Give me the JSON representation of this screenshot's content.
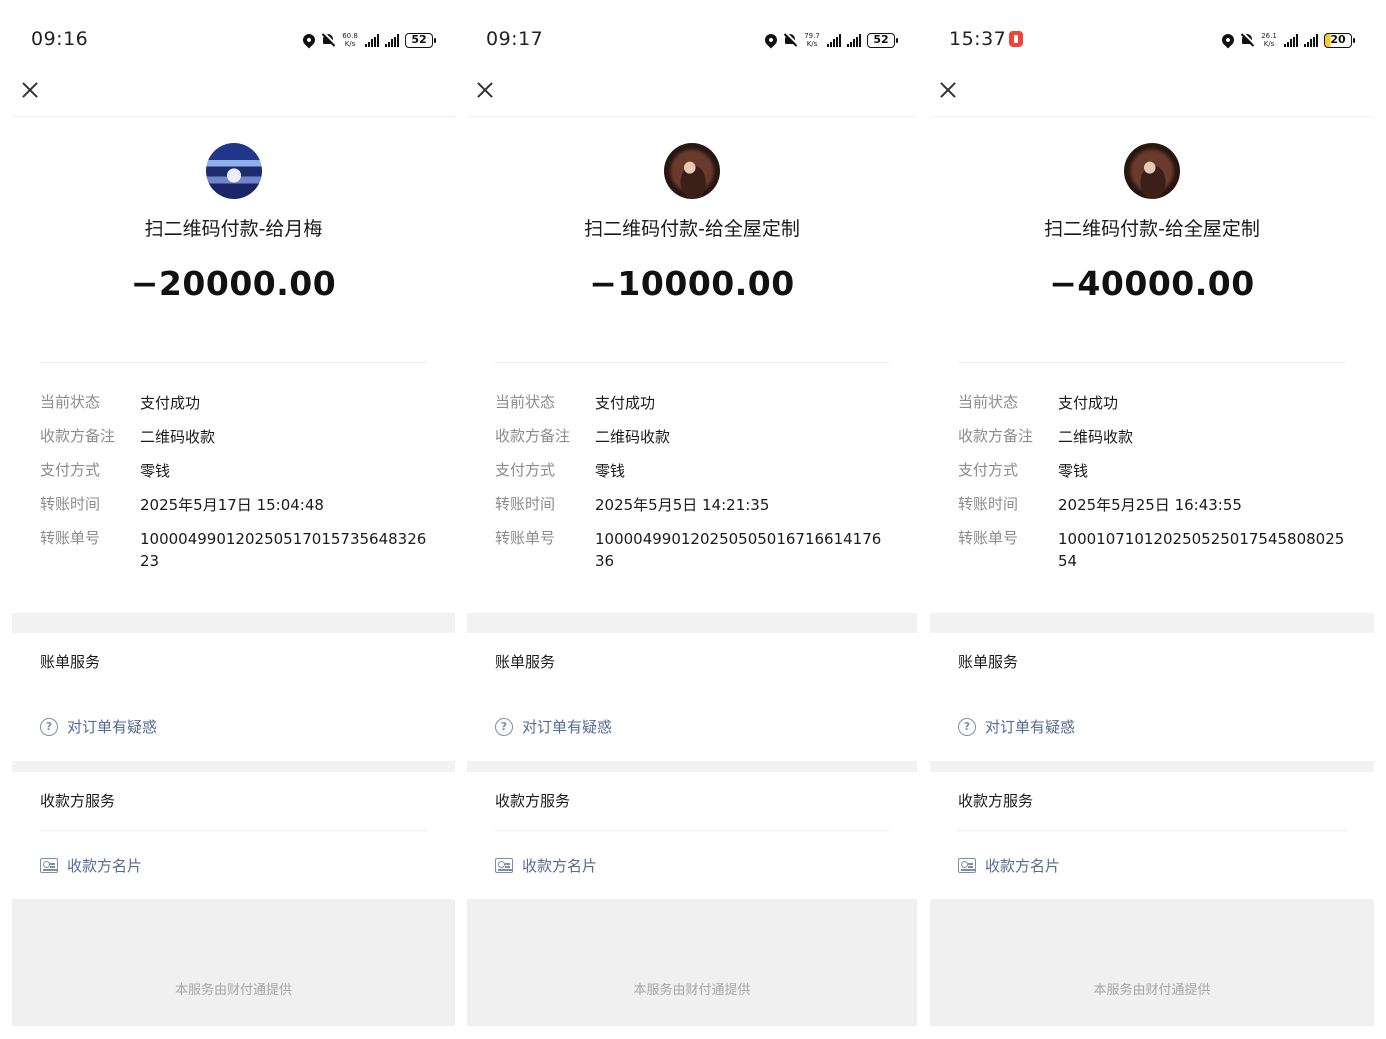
{
  "common": {
    "section_bill": "账单服务",
    "link_question": "对订单有疑惑",
    "section_payee": "收款方服务",
    "link_card": "收款方名片",
    "provider_note": "本服务由财付通提供",
    "labels": {
      "status": "当前状态",
      "remark": "收款方备注",
      "method": "支付方式",
      "time": "转账时间",
      "order": "转账单号"
    },
    "accent_link_color": "#576b95"
  },
  "panels": [
    {
      "status_time": "09:16",
      "net_speed_top": "60.8",
      "net_speed_unit": "K/s",
      "battery": "52",
      "avatar_icon": "office-photo-avatar",
      "payee": "扫二维码付款-给月梅",
      "amount": "−20000.00",
      "status": "支付成功",
      "remark": "二维码收款",
      "method": "零钱",
      "time": "2025年5月17日 15:04:48",
      "order": "100004990120250517015735648326 23"
    },
    {
      "status_time": "09:17",
      "net_speed_top": "79.7",
      "net_speed_unit": "K/s",
      "battery": "52",
      "avatar_icon": "person-photo-avatar",
      "payee": "扫二维码付款-给全屋定制",
      "amount": "−10000.00",
      "status": "支付成功",
      "remark": "二维码收款",
      "method": "零钱",
      "time": "2025年5月5日 14:21:35",
      "order": "100004990120250505016716614176 36"
    },
    {
      "status_time": "15:37",
      "net_speed_top": "26.1",
      "net_speed_unit": "K/s",
      "battery": "20",
      "avatar_icon": "person-photo-avatar",
      "payee": "扫二维码付款-给全屋定制",
      "amount": "−40000.00",
      "status": "支付成功",
      "remark": "二维码收款",
      "method": "零钱",
      "time": "2025年5月25日 16:43:55",
      "order": "100010710120250525017545808025 54"
    }
  ]
}
